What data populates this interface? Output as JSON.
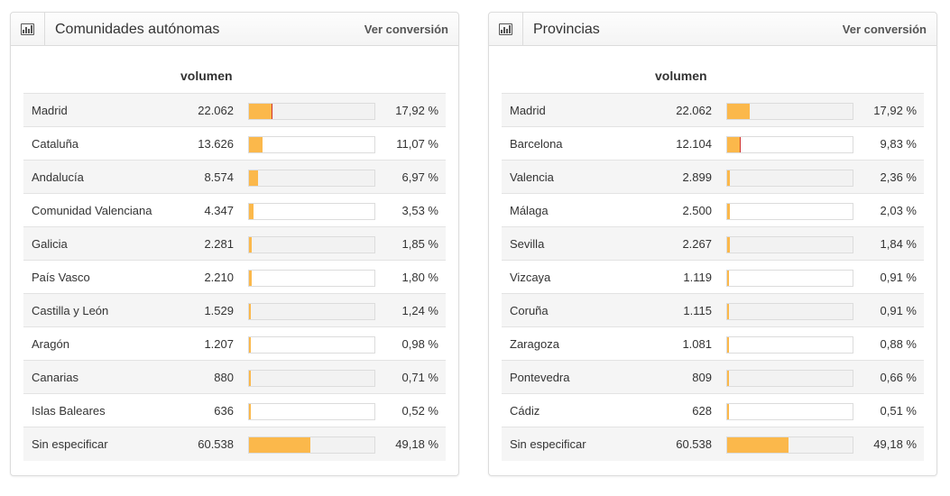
{
  "colors": {
    "bar": "#fbb84b",
    "marker": "#d0322a"
  },
  "panels": [
    {
      "title": "Comunidades autónomas",
      "link": "Ver conversión",
      "icon": "bar-chart-icon",
      "column": "volumen",
      "marker_row": 0,
      "rows": [
        {
          "name": "Madrid",
          "volume": "22.062",
          "pct": "17,92 %",
          "fraction": 0.1792
        },
        {
          "name": "Cataluña",
          "volume": "13.626",
          "pct": "11,07 %",
          "fraction": 0.1107
        },
        {
          "name": "Andalucía",
          "volume": "8.574",
          "pct": "6,97 %",
          "fraction": 0.0697
        },
        {
          "name": "Comunidad Valenciana",
          "volume": "4.347",
          "pct": "3,53 %",
          "fraction": 0.0353
        },
        {
          "name": "Galicia",
          "volume": "2.281",
          "pct": "1,85 %",
          "fraction": 0.0185
        },
        {
          "name": "País Vasco",
          "volume": "2.210",
          "pct": "1,80 %",
          "fraction": 0.018
        },
        {
          "name": "Castilla y León",
          "volume": "1.529",
          "pct": "1,24 %",
          "fraction": 0.0124
        },
        {
          "name": "Aragón",
          "volume": "1.207",
          "pct": "0,98 %",
          "fraction": 0.0098
        },
        {
          "name": "Canarias",
          "volume": "880",
          "pct": "0,71 %",
          "fraction": 0.0071
        },
        {
          "name": "Islas Baleares",
          "volume": "636",
          "pct": "0,52 %",
          "fraction": 0.0052
        },
        {
          "name": "Sin especificar",
          "volume": "60.538",
          "pct": "49,18 %",
          "fraction": 0.4918
        }
      ]
    },
    {
      "title": "Provincias",
      "link": "Ver conversión",
      "icon": "bar-chart-icon",
      "column": "volumen",
      "marker_row": 1,
      "rows": [
        {
          "name": "Madrid",
          "volume": "22.062",
          "pct": "17,92 %",
          "fraction": 0.1792
        },
        {
          "name": "Barcelona",
          "volume": "12.104",
          "pct": "9,83 %",
          "fraction": 0.0983
        },
        {
          "name": "Valencia",
          "volume": "2.899",
          "pct": "2,36 %",
          "fraction": 0.0236
        },
        {
          "name": "Málaga",
          "volume": "2.500",
          "pct": "2,03 %",
          "fraction": 0.0203
        },
        {
          "name": "Sevilla",
          "volume": "2.267",
          "pct": "1,84 %",
          "fraction": 0.0184
        },
        {
          "name": "Vizcaya",
          "volume": "1.119",
          "pct": "0,91 %",
          "fraction": 0.0091
        },
        {
          "name": "Coruña",
          "volume": "1.115",
          "pct": "0,91 %",
          "fraction": 0.0091
        },
        {
          "name": "Zaragoza",
          "volume": "1.081",
          "pct": "0,88 %",
          "fraction": 0.0088
        },
        {
          "name": "Pontevedra",
          "volume": "809",
          "pct": "0,66 %",
          "fraction": 0.0066
        },
        {
          "name": "Cádiz",
          "volume": "628",
          "pct": "0,51 %",
          "fraction": 0.0051
        },
        {
          "name": "Sin especificar",
          "volume": "60.538",
          "pct": "49,18 %",
          "fraction": 0.4918
        }
      ]
    }
  ]
}
